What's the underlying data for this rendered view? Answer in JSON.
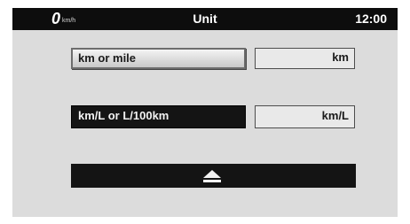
{
  "header": {
    "speed_value": "0",
    "speed_unit": "km/h",
    "title": "Unit",
    "clock": "12:00"
  },
  "settings": [
    {
      "label": "km or mile",
      "value": "km",
      "selected": true
    },
    {
      "label": "km/L or L/100km",
      "value": "km/L",
      "selected": false
    }
  ],
  "footer": {
    "back_icon": "eject-icon"
  },
  "colors": {
    "screen_background": "#dcdcdc",
    "bar_background": "#0d0d0d",
    "button_dark": "#141414",
    "button_light": "#e4e4e4"
  }
}
